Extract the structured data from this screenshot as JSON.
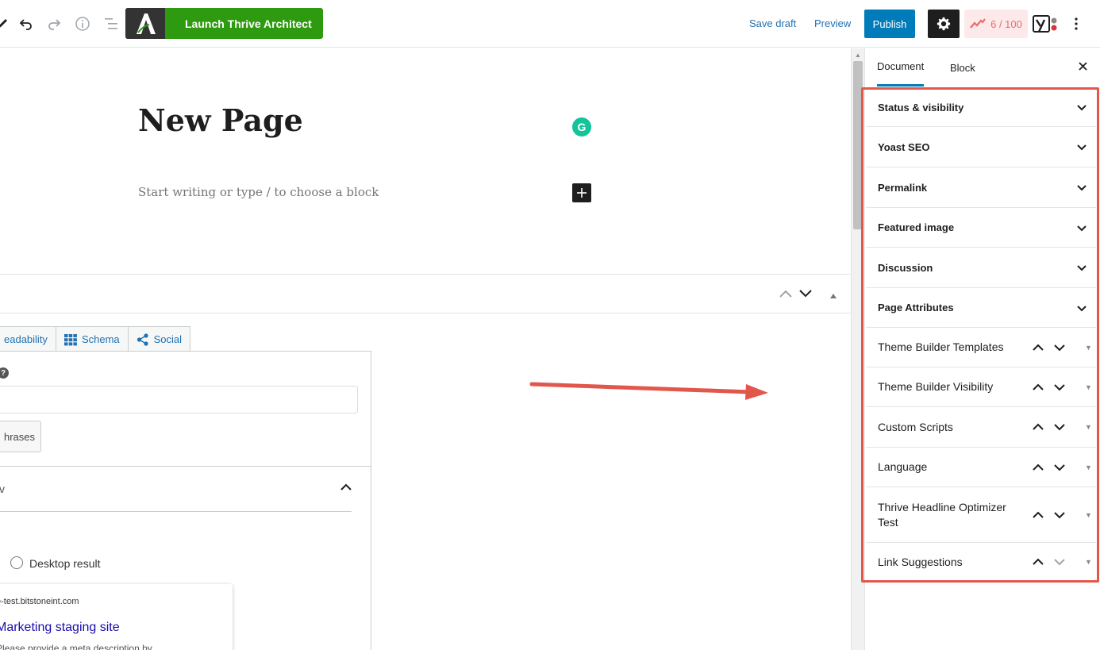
{
  "toolbar": {
    "launch_label": "Launch Thrive Architect",
    "save_draft": "Save draft",
    "preview": "Preview",
    "publish": "Publish",
    "score": "6 / 100",
    "icons": [
      "pencil-icon",
      "undo-icon",
      "redo-icon",
      "info-icon",
      "list-view-icon",
      "thrive-logo-icon",
      "gear-icon",
      "score-icon",
      "yoast-icon",
      "more-vertical-icon"
    ]
  },
  "editor": {
    "title": "New Page",
    "placeholder": "Start writing or type / to choose a block"
  },
  "yoast_box": {
    "tabs": [
      {
        "label": "eadability",
        "icon": "readability-icon"
      },
      {
        "label": "Schema",
        "icon": "grid-icon"
      },
      {
        "label": "Social",
        "icon": "share-icon"
      }
    ],
    "related_button": "hrases",
    "collapsed_label": "v",
    "radio_label": "Desktop result",
    "snippet": {
      "url": "e-test.bitstoneint.com",
      "title": "Marketing staging site",
      "description": "Please provide a meta description by"
    }
  },
  "sidebar": {
    "tabs": {
      "document": "Document",
      "block": "Block"
    },
    "panels": [
      {
        "label": "Status & visibility"
      },
      {
        "label": "Yoast SEO"
      },
      {
        "label": "Permalink"
      },
      {
        "label": "Featured image"
      },
      {
        "label": "Discussion"
      },
      {
        "label": "Page Attributes"
      },
      {
        "label": "Theme Builder Templates"
      },
      {
        "label": "Theme Builder Visibility"
      },
      {
        "label": "Custom Scripts"
      },
      {
        "label": "Language"
      },
      {
        "label": "Thrive Headline Optimizer Test"
      },
      {
        "label": "Link Suggestions"
      }
    ]
  },
  "colors": {
    "accent": "#007cba",
    "thrive_green": "#2e9a0f",
    "highlight": "#e2574c",
    "score_red": "#e86d6d"
  }
}
